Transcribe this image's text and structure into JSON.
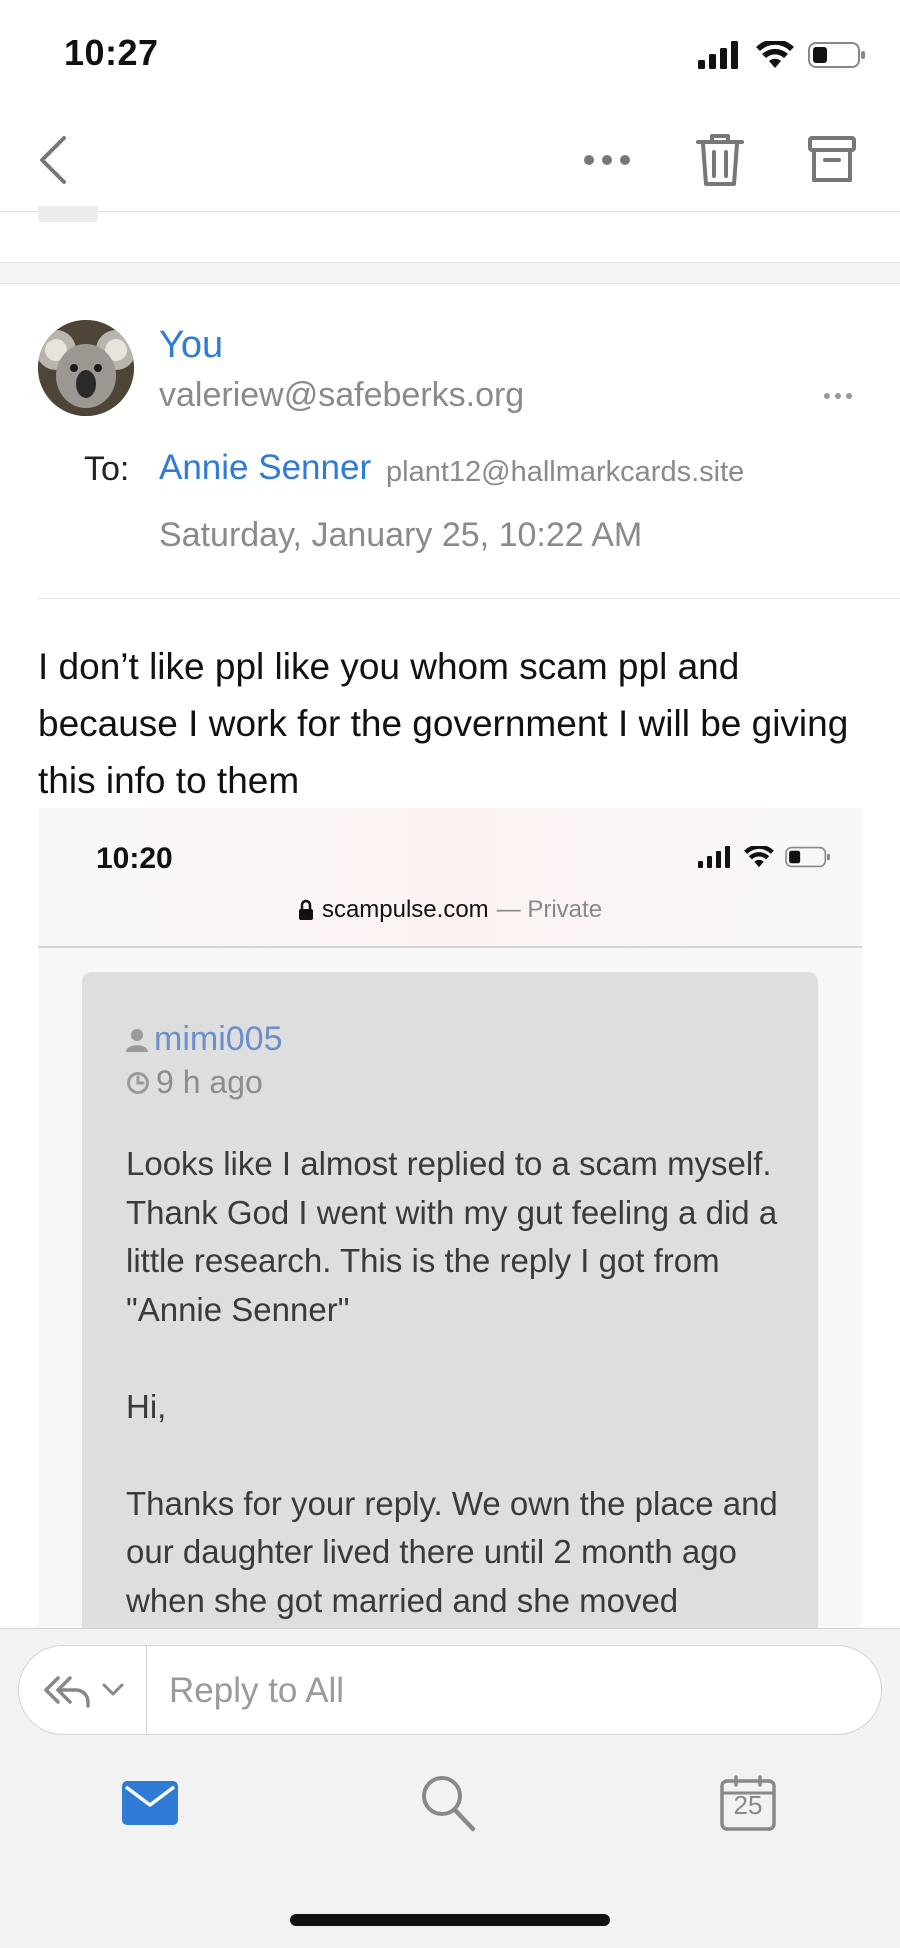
{
  "status_bar": {
    "time": "10:27"
  },
  "nav": {
    "back_icon": "chevron-left-icon",
    "more_icon": "more-horizontal-icon",
    "delete_icon": "trash-icon",
    "archive_icon": "archive-icon"
  },
  "message": {
    "from_name": "You",
    "from_email": "valeriew@safeberks.org",
    "to_label": "To:",
    "to_name": "Annie Senner",
    "to_email": "plant12@hallmarkcards.site",
    "date": "Saturday, January 25, 10:22 AM",
    "body": "I don’t like ppl like you whom scam ppl and because I work for the government I will be giving this info to them"
  },
  "embedded_screenshot": {
    "time": "10:20",
    "site": "scampulse.com",
    "private_label": "— Private",
    "username": "mimi005",
    "posted_ago": "9 h ago",
    "post_text": "Looks like I almost replied to a scam myself. Thank God I went with my gut feeling a did a little research. This is the reply I got from \"Annie Senner\"\n\nHi,\n\nThanks for your reply. We own the place and our daughter lived there until 2 month ago when she got married and she moved"
  },
  "reply": {
    "placeholder": "Reply to All",
    "icon": "reply-all-icon"
  },
  "tabs": [
    {
      "name": "mail",
      "icon": "mail-icon",
      "active": true
    },
    {
      "name": "search",
      "icon": "search-icon",
      "active": false
    },
    {
      "name": "calendar",
      "icon": "calendar-icon",
      "day": "25",
      "active": false
    }
  ],
  "colors": {
    "accent": "#2f7bd6",
    "secondary_text": "#8a8a8a",
    "icon_gray": "#777777"
  }
}
